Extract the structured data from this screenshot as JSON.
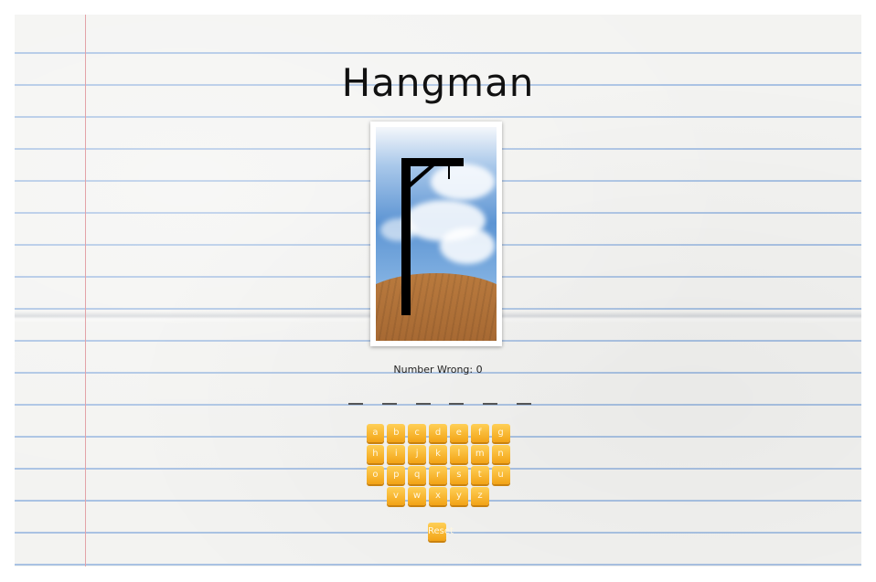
{
  "game": {
    "title": "Hangman",
    "number_wrong_text": "Number Wrong: 0",
    "number_wrong": 0,
    "word_length": 6,
    "keyboard_rows": [
      [
        "a",
        "b",
        "c",
        "d",
        "e",
        "f",
        "g"
      ],
      [
        "h",
        "i",
        "j",
        "k",
        "l",
        "m",
        "n"
      ],
      [
        "o",
        "p",
        "q",
        "r",
        "s",
        "t",
        "u"
      ],
      [
        "v",
        "w",
        "x",
        "y",
        "z"
      ]
    ],
    "reset_label": "Reset"
  },
  "colors": {
    "key_orange": "#f5b02c",
    "paper": "#f3f3f1",
    "rule_line": "#a9c2e3",
    "margin_line": "#e3a3a8",
    "gallows": "#000000"
  },
  "icons": {
    "picture": "gallows-illustration"
  }
}
